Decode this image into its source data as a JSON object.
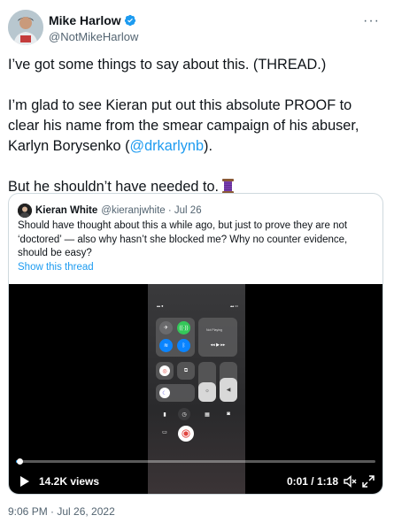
{
  "tweet": {
    "display_name": "Mike Harlow",
    "handle": "@NotMikeHarlow",
    "more_label": "···",
    "text_line1": "I’ve got some things to say about this. (THREAD.)",
    "text_line2_prefix": "I’m glad to see Kieran put out this absolute PROOF to clear his name from the smear campaign of his abuser, Karlyn Borysenko (",
    "mention": "@drkarlynb",
    "text_line2_suffix": ").",
    "text_line3": "But he shouldn’t have needed to.",
    "emoji": "spool-of-thread-icon",
    "timestamp": "9:06 PM · Jul 26, 2022"
  },
  "quote": {
    "display_name": "Kieran White",
    "handle": "@kieranjwhite · Jul 26",
    "text": "Should have thought about this a while ago, but just to prove they are not ‘doctored’ — also why hasn’t she blocked me? Why no counter evidence, should be easy?",
    "show_thread": "Show this thread"
  },
  "video": {
    "views": "14.2K views",
    "time": "0:01 / 1:18",
    "progress_fraction": 0.01,
    "phone_status_left": "▴▴ ●",
    "phone_status_right": "▴▴ ▭",
    "now_playing": "Not Playing"
  },
  "colors": {
    "accent": "#1d9bf0",
    "text": "#0f1419",
    "secondary": "#536471"
  }
}
